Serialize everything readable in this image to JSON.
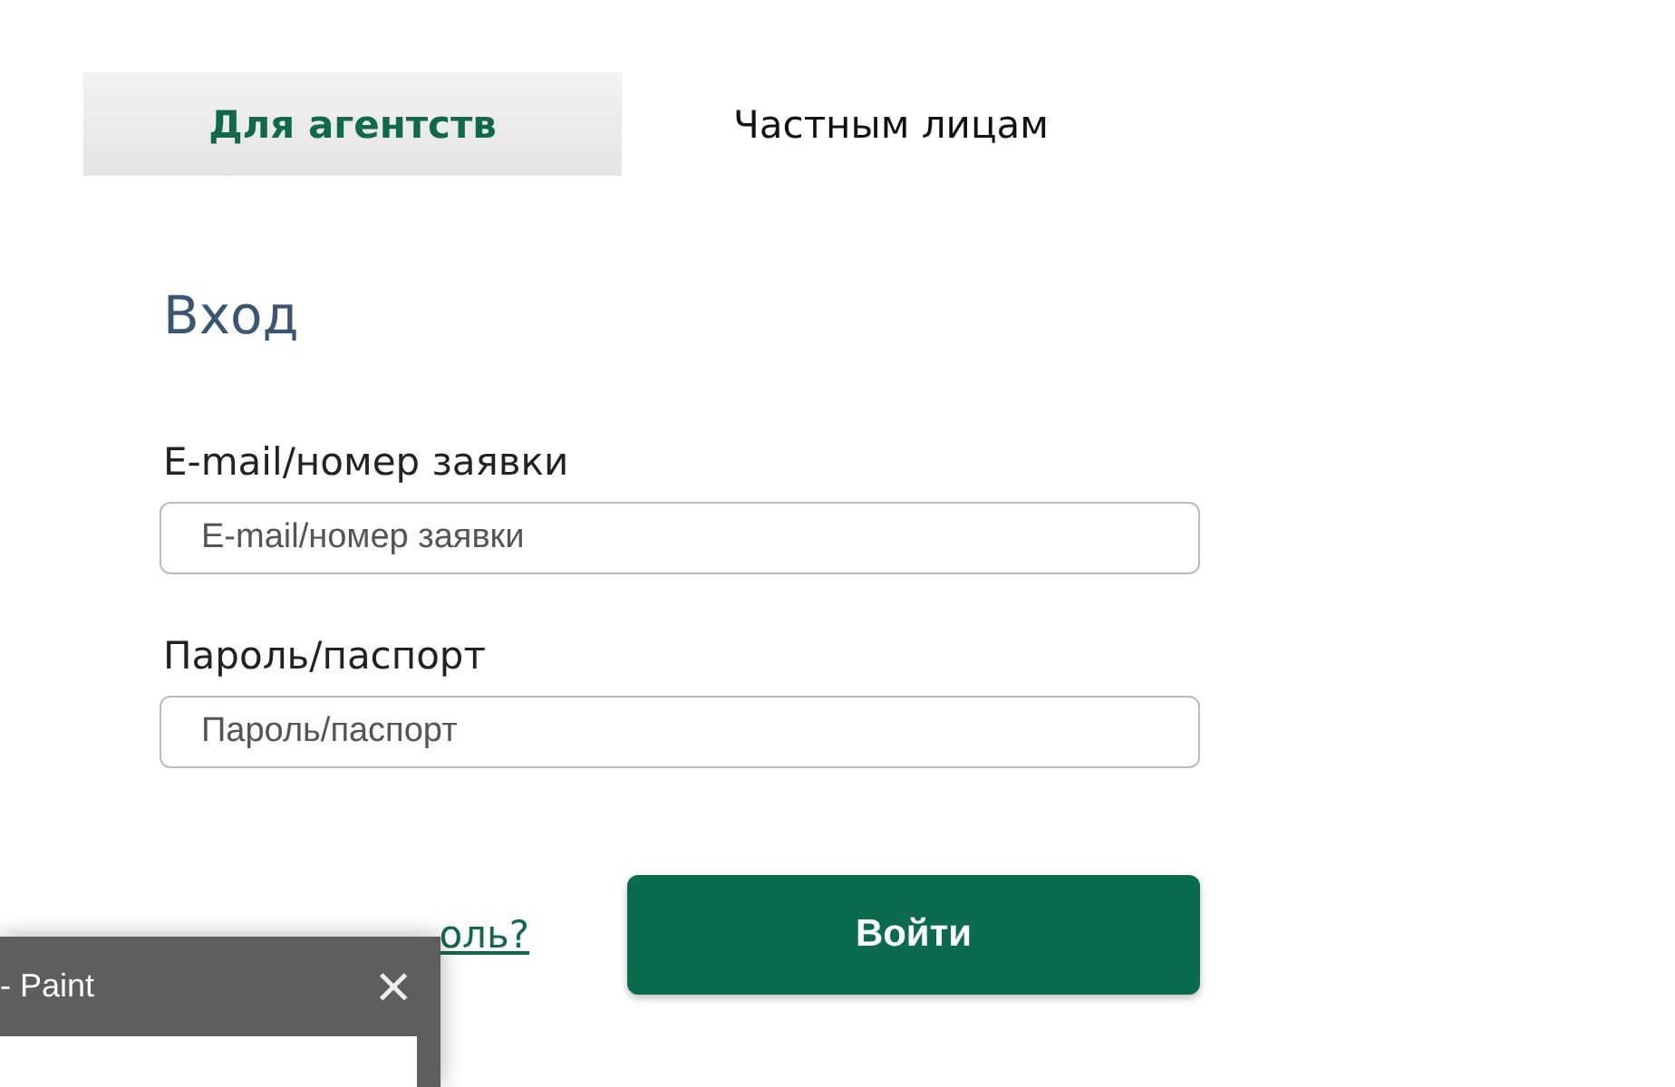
{
  "tabs": [
    {
      "label": "Для агентств",
      "selected": true
    },
    {
      "label": "Частным лицам",
      "selected": false
    }
  ],
  "form": {
    "title": "Вход",
    "fields": [
      {
        "label": "E-mail/номер заявки",
        "placeholder": "E-mail/номер заявки"
      },
      {
        "label": "Пароль/паспорт",
        "placeholder": "Пароль/паспорт"
      }
    ],
    "forgot_link": "оль?",
    "submit": "Войти"
  },
  "overlay_window": {
    "title": "- Paint",
    "close": "×"
  }
}
